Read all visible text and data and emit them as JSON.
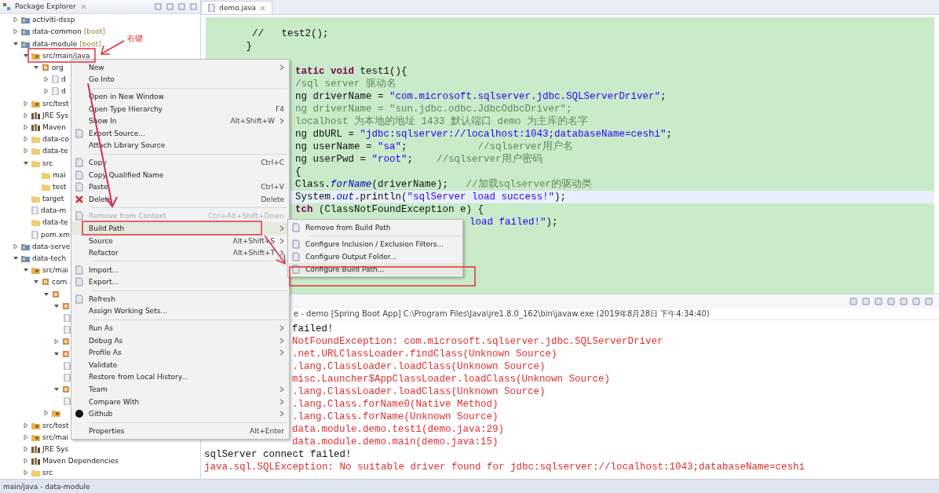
{
  "package_explorer": {
    "title": "Package Explorer",
    "tree": [
      {
        "label": "activiti-dssp",
        "kind": "project",
        "expanded": false
      },
      {
        "label": "data-common",
        "tag": "[boot]",
        "kind": "project",
        "expanded": false
      },
      {
        "label": "data-module",
        "tag": "[boot]",
        "kind": "project",
        "expanded": true,
        "children": [
          {
            "label": "src/main/java",
            "kind": "source-folder",
            "expanded": true,
            "children": [
              {
                "label": "org",
                "kind": "package",
                "expanded": true,
                "children": [
                  {
                    "label": "d",
                    "kind": "file",
                    "expanded": false
                  },
                  {
                    "label": "d",
                    "kind": "file",
                    "expanded": false
                  }
                ]
              }
            ]
          },
          {
            "label": "src/test",
            "kind": "source-folder",
            "expanded": false
          },
          {
            "label": "JRE Sys",
            "kind": "library",
            "expanded": false
          },
          {
            "label": "Maven",
            "kind": "library",
            "expanded": false
          },
          {
            "label": "data-co",
            "kind": "folder",
            "expanded": false
          },
          {
            "label": "data-te",
            "kind": "folder",
            "expanded": false
          },
          {
            "label": "src",
            "kind": "folder",
            "expanded": true,
            "children": [
              {
                "label": "mai",
                "kind": "folder"
              },
              {
                "label": "test",
                "kind": "folder"
              }
            ]
          },
          {
            "label": "target",
            "kind": "folder"
          },
          {
            "label": "data-m",
            "kind": "file"
          },
          {
            "label": "data-te",
            "kind": "folder"
          },
          {
            "label": "pom.xm",
            "kind": "file"
          }
        ]
      },
      {
        "label": "data-serve",
        "kind": "project",
        "expanded": false
      },
      {
        "label": "data-tech",
        "kind": "project",
        "expanded": true,
        "children": [
          {
            "label": "src/mai",
            "kind": "source-folder",
            "expanded": true,
            "children": [
              {
                "label": "com",
                "kind": "package",
                "expanded": true,
                "children": [
                  {
                    "kind": "package",
                    "expanded": true,
                    "children": [
                      {
                        "kind": "package",
                        "expanded": true,
                        "children": [
                          {
                            "kind": "file"
                          },
                          {
                            "kind": "file"
                          }
                        ]
                      },
                      {
                        "kind": "package",
                        "expanded": false
                      },
                      {
                        "kind": "package",
                        "expanded": true,
                        "children": [
                          {
                            "kind": "file"
                          },
                          {
                            "kind": "file"
                          }
                        ]
                      },
                      {
                        "kind": "package",
                        "expanded": true,
                        "children": [
                          {
                            "kind": "file"
                          }
                        ]
                      }
                    ]
                  },
                  {
                    "kind": "source-folder",
                    "expanded": false
                  }
                ]
              }
            ]
          },
          {
            "label": "src/test",
            "kind": "source-folder",
            "expanded": false
          },
          {
            "label": "src/mai",
            "kind": "source-folder",
            "expanded": false
          },
          {
            "label": "JRE Sys",
            "kind": "library",
            "expanded": false
          },
          {
            "label": "Maven Dependencies",
            "kind": "library",
            "expanded": false
          },
          {
            "label": "src",
            "kind": "folder",
            "expanded": false
          }
        ]
      }
    ]
  },
  "editor": {
    "tab": "demo.java",
    "lines": [
      {
        "kind": "full",
        "selected": false,
        "segs": [
          {
            "kind": "code",
            "t": "  //   test2();"
          }
        ]
      },
      {
        "kind": "full",
        "selected": false,
        "segs": [
          {
            "kind": "code",
            "t": " }"
          }
        ]
      },
      {
        "kind": "blank",
        "selected": false
      },
      {
        "kind": "partial",
        "selected": false,
        "segs": [
          {
            "kind": "keyword",
            "t": "tatic void "
          },
          {
            "kind": "code",
            "t": "test1(){"
          }
        ]
      },
      {
        "kind": "partial",
        "selected": false,
        "segs": [
          {
            "kind": "comment",
            "t": "/sql server 驱动名"
          }
        ]
      },
      {
        "kind": "partial",
        "selected": false,
        "segs": [
          {
            "kind": "code",
            "t": "ng driverName = "
          },
          {
            "kind": "string",
            "t": "\"com.microsoft.sqlserver.jdbc.SQLServerDriver\""
          },
          {
            "kind": "code",
            "t": ";"
          }
        ]
      },
      {
        "kind": "partial",
        "selected": false,
        "segs": [
          {
            "kind": "comment",
            "t": "ng driverName = \"sun.jdbc.odbc.JdbcOdbcDriver\";"
          }
        ]
      },
      {
        "kind": "partial",
        "selected": false,
        "segs": [
          {
            "kind": "comment",
            "t": "localhost 为本地的地址 1433 默认端口 demo 为主库的名字"
          }
        ]
      },
      {
        "kind": "partial",
        "selected": false,
        "segs": [
          {
            "kind": "code",
            "t": "ng dbURL = "
          },
          {
            "kind": "string",
            "t": "\"jdbc:sqlserver://localhost:1043;databaseName=ceshi\""
          },
          {
            "kind": "code",
            "t": ";"
          }
        ]
      },
      {
        "kind": "partial",
        "selected": false,
        "segs": [
          {
            "kind": "code",
            "t": "ng userName = "
          },
          {
            "kind": "string",
            "t": "\"sa\""
          },
          {
            "kind": "code",
            "t": ";            "
          },
          {
            "kind": "comment",
            "t": "//sqlserver用户名"
          }
        ]
      },
      {
        "kind": "partial",
        "selected": false,
        "segs": [
          {
            "kind": "code",
            "t": "ng userPwd = "
          },
          {
            "kind": "string",
            "t": "\"root\""
          },
          {
            "kind": "code",
            "t": ";    "
          },
          {
            "kind": "comment",
            "t": "//sqlserver用户密码"
          }
        ]
      },
      {
        "kind": "partial",
        "selected": false,
        "segs": [
          {
            "kind": "code",
            "t": "{"
          }
        ]
      },
      {
        "kind": "partial",
        "selected": false,
        "segs": [
          {
            "kind": "code",
            "t": "Class."
          },
          {
            "kind": "static",
            "t": "forName"
          },
          {
            "kind": "code",
            "t": "(driverName);   "
          },
          {
            "kind": "comment",
            "t": "//加载sqlserver的驱动类"
          }
        ]
      },
      {
        "kind": "partial",
        "selected": true,
        "segs": [
          {
            "kind": "code",
            "t": "System."
          },
          {
            "kind": "static",
            "t": "out"
          },
          {
            "kind": "code",
            "t": ".println("
          },
          {
            "kind": "string",
            "t": "\"sqlServer load success!\""
          },
          {
            "kind": "code",
            "t": ");"
          }
        ]
      },
      {
        "kind": "partial",
        "selected": false,
        "segs": [
          {
            "kind": "keyword",
            "t": "tch"
          },
          {
            "kind": "code",
            "t": " (ClassNotFoundException e) {"
          }
        ]
      },
      {
        "kind": "tail",
        "selected": false,
        "segs": [
          {
            "kind": "string",
            "t": "load failed!\""
          },
          {
            "kind": "code",
            "t": ");"
          }
        ]
      }
    ]
  },
  "console": {
    "header": "e - demo [Spring Boot App] C:\\Program Files\\Java\\jre1.8.0_162\\bin\\javaw.exe (2019年8月28日 下午4:34:40)",
    "lines": [
      {
        "kind": "cut",
        "color": "#111111",
        "text": "failed!"
      },
      {
        "kind": "cut",
        "color": "#e03030",
        "text": "NotFoundException: com.microsoft.sqlserver.jdbc.SQLServerDriver"
      },
      {
        "kind": "cut",
        "color": "#e03030",
        "text": ".net.URLClassLoader.findClass(Unknown Source)"
      },
      {
        "kind": "cut",
        "color": "#e03030",
        "text": ".lang.ClassLoader.loadClass(Unknown Source)"
      },
      {
        "kind": "cut",
        "color": "#e03030",
        "text": "misc.Launcher$AppClassLoader.loadClass(Unknown Source)"
      },
      {
        "kind": "cut",
        "color": "#e03030",
        "text": ".lang.ClassLoader.loadClass(Unknown Source)"
      },
      {
        "kind": "cut",
        "color": "#e03030",
        "text": ".lang.Class.forName0(Native Method)"
      },
      {
        "kind": "cut",
        "color": "#e03030",
        "text": ".lang.Class.forName(Unknown Source)"
      },
      {
        "kind": "cut",
        "color": "#e03030",
        "text": "data.module.demo.test1(demo.java:29)"
      },
      {
        "kind": "cut",
        "color": "#e03030",
        "text": "data.module.demo.main(demo.java:15)"
      },
      {
        "kind": "full",
        "color": "#111111",
        "text": "sqlServer connect failed!"
      },
      {
        "kind": "full",
        "color": "#e03030",
        "text": "java.sql.SQLException: No suitable driver found for jdbc:sqlserver://localhost:1043;databaseName=ceshi"
      }
    ]
  },
  "context_menu": {
    "items": [
      {
        "kind": "item",
        "label": "New",
        "submenu": true,
        "disabled": false,
        "selected": false
      },
      {
        "kind": "item",
        "label": "Go Into",
        "submenu": false,
        "disabled": false,
        "selected": false
      },
      {
        "kind": "separator"
      },
      {
        "kind": "item",
        "label": "Open in New Window",
        "submenu": false,
        "disabled": false,
        "selected": false
      },
      {
        "kind": "item",
        "label": "Open Type Hierarchy",
        "shortcut": "F4",
        "submenu": false,
        "disabled": false,
        "selected": false
      },
      {
        "kind": "item",
        "label": "Show In",
        "shortcut": "Alt+Shift+W",
        "submenu": true,
        "disabled": false,
        "selected": false
      },
      {
        "kind": "icon-item",
        "label": "Export Source...",
        "submenu": false,
        "disabled": false,
        "selected": false
      },
      {
        "kind": "item",
        "label": "Attach Library Source",
        "submenu": false,
        "disabled": false,
        "selected": false
      },
      {
        "kind": "separator"
      },
      {
        "kind": "icon-item",
        "label": "Copy",
        "shortcut": "Ctrl+C",
        "submenu": false,
        "disabled": false,
        "selected": false
      },
      {
        "kind": "icon-item",
        "label": "Copy Qualified Name",
        "submenu": false,
        "disabled": false,
        "selected": false
      },
      {
        "kind": "icon-item",
        "label": "Paste",
        "shortcut": "Ctrl+V",
        "submenu": false,
        "disabled": false,
        "selected": false
      },
      {
        "kind": "delete-item",
        "label": "Delete",
        "shortcut": "Delete",
        "submenu": false,
        "disabled": false,
        "selected": false
      },
      {
        "kind": "separator"
      },
      {
        "kind": "icon-item",
        "label": "Remove from Context",
        "shortcut": "Ctrl+Alt+Shift+Down",
        "submenu": false,
        "disabled": true,
        "selected": false
      },
      {
        "kind": "item",
        "label": "Build Path",
        "submenu": true,
        "disabled": false,
        "selected": true
      },
      {
        "kind": "item",
        "label": "Source",
        "shortcut": "Alt+Shift+S",
        "submenu": true,
        "disabled": false,
        "selected": false
      },
      {
        "kind": "item",
        "label": "Refactor",
        "shortcut": "Alt+Shift+T",
        "submenu": true,
        "disabled": false,
        "selected": false
      },
      {
        "kind": "separator"
      },
      {
        "kind": "icon-item",
        "label": "Import...",
        "submenu": false,
        "disabled": false,
        "selected": false
      },
      {
        "kind": "icon-item",
        "label": "Export...",
        "submenu": false,
        "disabled": false,
        "selected": false
      },
      {
        "kind": "separator"
      },
      {
        "kind": "icon-item",
        "label": "Refresh",
        "submenu": false,
        "disabled": false,
        "selected": false
      },
      {
        "kind": "item",
        "label": "Assign Working Sets...",
        "submenu": false,
        "disabled": false,
        "selected": false
      },
      {
        "kind": "separator"
      },
      {
        "kind": "item",
        "label": "Run As",
        "submenu": true,
        "disabled": false,
        "selected": false
      },
      {
        "kind": "item",
        "label": "Debug As",
        "submenu": true,
        "disabled": false,
        "selected": false
      },
      {
        "kind": "item",
        "label": "Profile As",
        "submenu": true,
        "disabled": false,
        "selected": false
      },
      {
        "kind": "item",
        "label": "Validate",
        "submenu": false,
        "disabled": false,
        "selected": false
      },
      {
        "kind": "item",
        "label": "Restore from Local History...",
        "submenu": false,
        "disabled": false,
        "selected": false
      },
      {
        "kind": "item",
        "label": "Team",
        "submenu": true,
        "disabled": false,
        "selected": false
      },
      {
        "kind": "item",
        "label": "Compare With",
        "submenu": true,
        "disabled": false,
        "selected": false
      },
      {
        "kind": "github-item",
        "label": "Github",
        "submenu": true,
        "disabled": false,
        "selected": false
      },
      {
        "kind": "separator"
      },
      {
        "kind": "item",
        "label": "Properties",
        "shortcut": "Alt+Enter",
        "submenu": false,
        "disabled": false,
        "selected": false
      }
    ]
  },
  "build_path_submenu": {
    "items": [
      {
        "kind": "icon-item",
        "label": "Remove from Build Path",
        "selected": false
      },
      {
        "kind": "separator"
      },
      {
        "kind": "icon-item",
        "label": "Configure Inclusion / Exclusion Filters...",
        "selected": false
      },
      {
        "kind": "icon-item",
        "label": "Configure Output Folder...",
        "selected": false
      },
      {
        "kind": "icon-item",
        "label": "Configure Build Path...",
        "selected": true
      }
    ]
  },
  "annotation": {
    "label": "右键"
  },
  "status_bar": {
    "text": "main/java - data-module"
  }
}
